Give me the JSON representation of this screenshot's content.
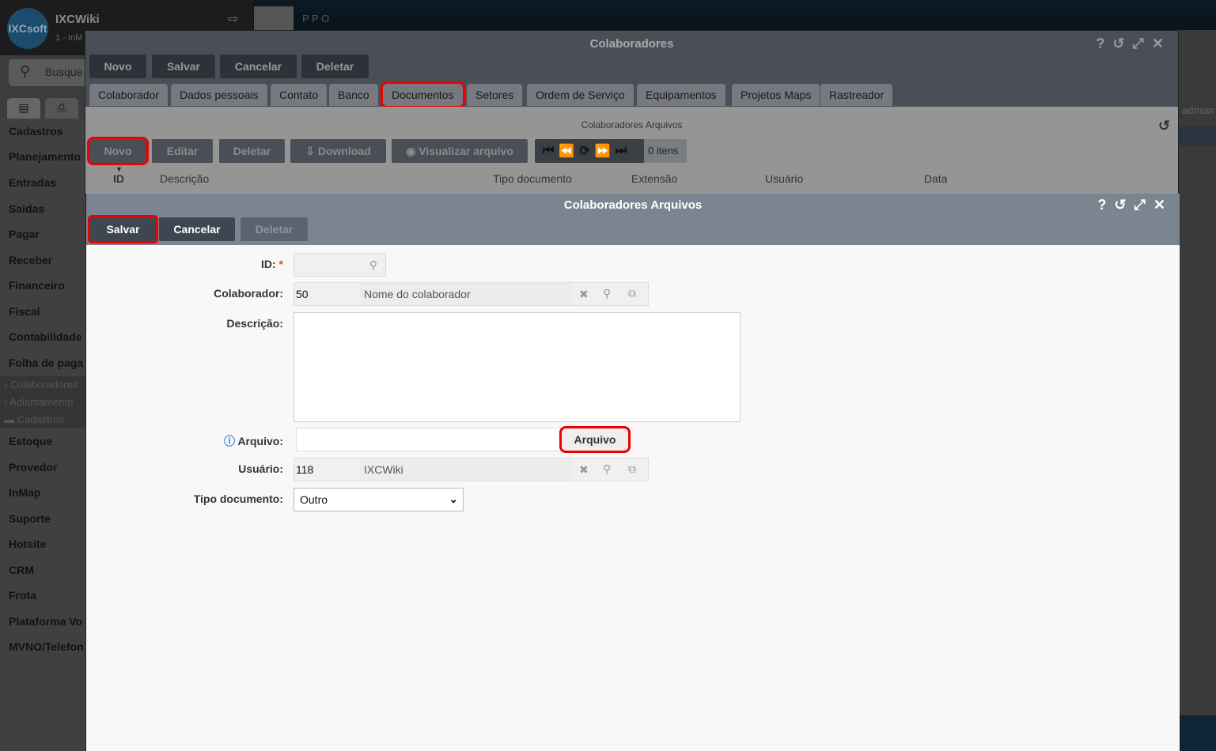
{
  "app": {
    "title": "IXCWiki",
    "subtitle": "1 - InM",
    "search_placeholder": "Busque",
    "behind_title": "P P O",
    "behind_user": "admiss"
  },
  "sidebar": {
    "items": [
      "Cadastros",
      "Planejamento",
      "Entradas",
      "Saidas",
      "Pagar",
      "Receber",
      "Financeiro",
      "Fiscal",
      "Contabilidade",
      "Folha de paga"
    ],
    "subitems": [
      "Colaboradores",
      "Adiantamento",
      "Cadastros"
    ],
    "items2": [
      "Estoque",
      "Provedor",
      "InMap",
      "Suporte",
      "Hotsite",
      "CRM",
      "Frota",
      "Plataforma Vo",
      "MVNO/Telefon"
    ]
  },
  "outer": {
    "title": "Colaboradores",
    "buttons": [
      "Novo",
      "Salvar",
      "Cancelar",
      "Deletar"
    ],
    "tabs": [
      "Colaborador",
      "Dados pessoais",
      "Contato",
      "Banco",
      "Documentos",
      "Setores",
      "Ordem de Serviço",
      "Equipamentos",
      "Projetos Maps",
      "Rastreador"
    ],
    "active_tab": "Documentos",
    "grid": {
      "title": "Colaboradores Arquivos",
      "buttons": [
        "Novo",
        "Editar",
        "Deletar",
        "Download",
        "Visualizar arquivo"
      ],
      "count": "0 itens",
      "columns": [
        "ID",
        "Descrição",
        "Tipo documento",
        "Extensão",
        "Usuário",
        "Data"
      ]
    }
  },
  "inner": {
    "title": "Colaboradores Arquivos",
    "buttons": [
      "Salvar",
      "Cancelar",
      "Deletar"
    ],
    "form": {
      "id_label": "ID:",
      "required": "*",
      "colaborador_label": "Colaborador:",
      "colaborador_id": "50",
      "colaborador_name": "Nome do colaborador",
      "descricao_label": "Descrição:",
      "arquivo_label": "Arquivo:",
      "arquivo_button": "Arquivo",
      "usuario_label": "Usuário:",
      "usuario_id": "118",
      "usuario_name": "IXCWiki",
      "tipo_label": "Tipo documento:",
      "tipo_value": "Outro"
    }
  },
  "colors": {
    "highlight": "#e00000",
    "header_outer": "#4a4f57",
    "header_inner": "#7b8591"
  }
}
